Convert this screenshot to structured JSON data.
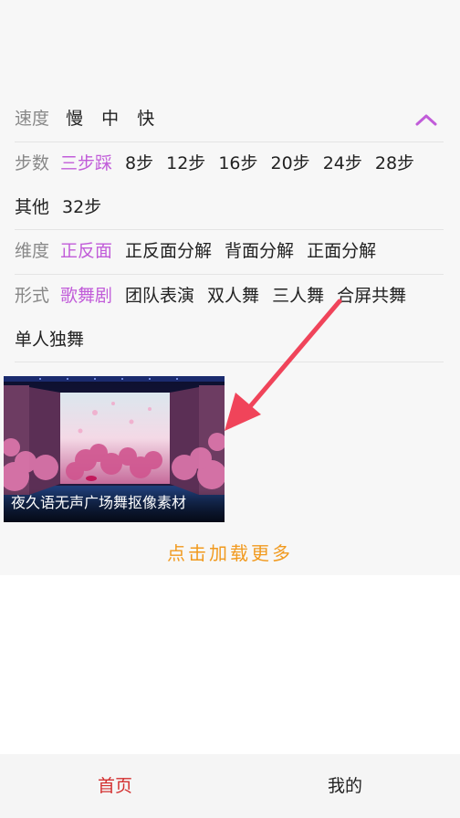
{
  "filters": {
    "speed": {
      "label": "速度",
      "options": [
        "慢",
        "中",
        "快"
      ]
    },
    "steps": {
      "label": "步数",
      "options": [
        "三步踩",
        "8步",
        "12步",
        "16步",
        "20步",
        "24步",
        "28步",
        "其他",
        "32步"
      ],
      "active_index": 0
    },
    "dimension": {
      "label": "维度",
      "options": [
        "正反面",
        "正反面分解",
        "背面分解",
        "正面分解"
      ],
      "active_index": 0
    },
    "form": {
      "label": "形式",
      "options": [
        "歌舞剧",
        "团队表演",
        "双人舞",
        "三人舞",
        "合屏共舞",
        "单人独舞"
      ],
      "active_index": 0
    }
  },
  "collapse_icon": "chevron-up-icon",
  "video": {
    "title": "夜久语无声广场舞抠像素材"
  },
  "load_more": "点击加载更多",
  "bottom_nav": {
    "home": "首页",
    "mine": "我的"
  },
  "colors": {
    "active_option": "#c15cd9",
    "load_more": "#f19a1f",
    "nav_active": "#d32f2f",
    "arrow": "#f0445a"
  }
}
